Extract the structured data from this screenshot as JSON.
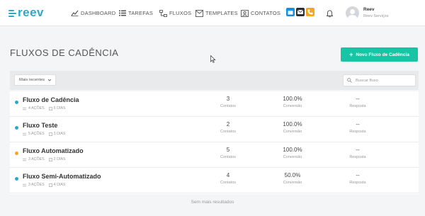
{
  "brand": {
    "logo_text": "reev",
    "accent": "#2aa9c8"
  },
  "nav": {
    "dashboard": "DASHBOARD",
    "tarefas": "TAREFAS",
    "fluxos": "FLUXOS",
    "templates": "TEMPLATES",
    "contatos": "CONTATOS"
  },
  "quick_actions": [
    {
      "icon": "calendar-icon",
      "color": "#1a8fe0"
    },
    {
      "icon": "mail-icon",
      "color": "#2c2f33"
    },
    {
      "icon": "phone-icon",
      "color": "#f5a623"
    }
  ],
  "user": {
    "name": "Reev",
    "org": "Reev Serviços"
  },
  "page": {
    "title": "FLUXOS DE CADÊNCIA",
    "new_button": "Novo Fluxo de Cadência",
    "new_button_color": "#17c5a4"
  },
  "filters": {
    "sort_value": "Mais recentes",
    "search_placeholder": "Buscar fluxo"
  },
  "flows": [
    {
      "name": "Fluxo de Cadência",
      "status_color": "#2aa9c8",
      "actions": "4 AÇÕES",
      "days": "6 DIAS",
      "contatos": "3",
      "contatos_label": "Contatos",
      "conversao": "100.0%",
      "conversao_label": "Conversão",
      "resposta": "--",
      "resposta_label": "Resposta"
    },
    {
      "name": "Fluxo Teste",
      "status_color": "#2aa9c8",
      "actions": "5 AÇÕES",
      "days": "3 DIAS",
      "contatos": "2",
      "contatos_label": "Contatos",
      "conversao": "100.0%",
      "conversao_label": "Conversão",
      "resposta": "--",
      "resposta_label": "Resposta"
    },
    {
      "name": "Fluxo Automatizado",
      "status_color": "#f5a623",
      "actions": "3 AÇÕES",
      "days": "2 DIAS",
      "contatos": "5",
      "contatos_label": "Contatos",
      "conversao": "100.0%",
      "conversao_label": "Conversão",
      "resposta": "--",
      "resposta_label": "Resposta"
    },
    {
      "name": "Fluxo Semi-Automatizado",
      "status_color": "#2aa9c8",
      "actions": "3 AÇÕES",
      "days": "4 DIAS",
      "contatos": "4",
      "contatos_label": "Contatos",
      "conversao": "50.0%",
      "conversao_label": "Conversão",
      "resposta": "--",
      "resposta_label": "Resposta"
    }
  ],
  "footer": {
    "no_more": "Sem mais resultados"
  }
}
